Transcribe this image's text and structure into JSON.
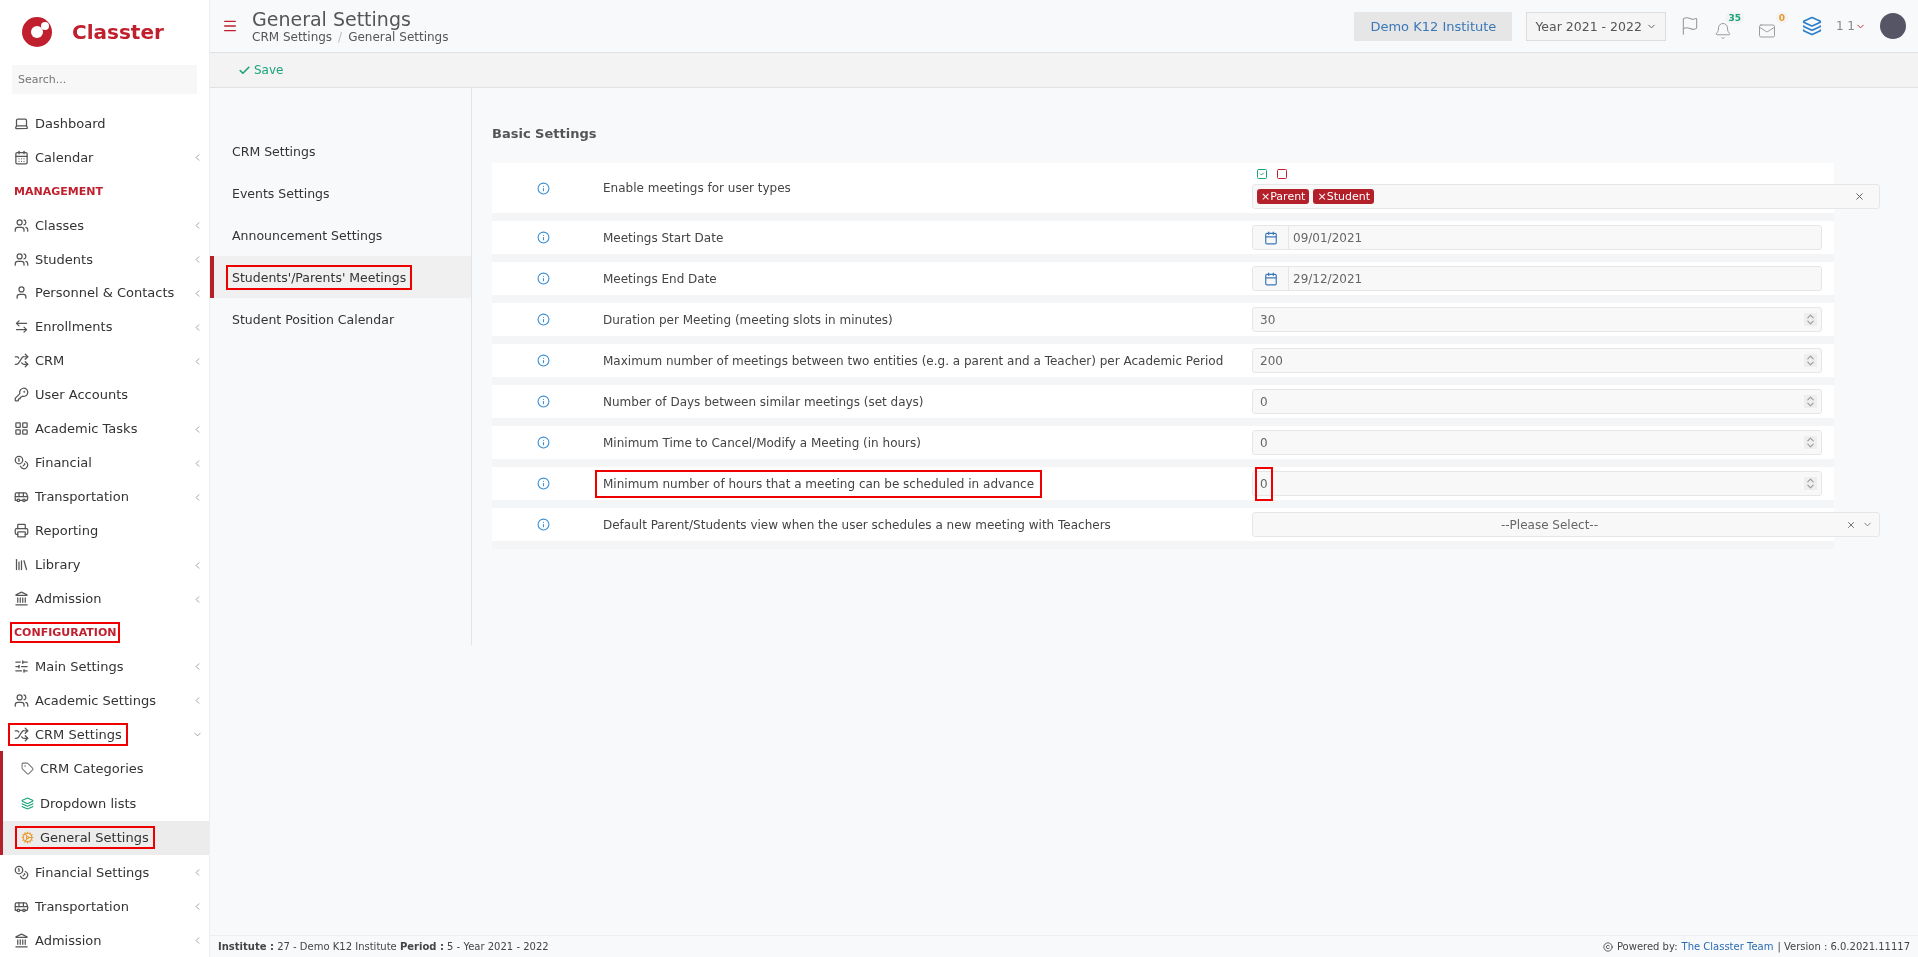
{
  "brand": {
    "name": "Classter"
  },
  "search": {
    "placeholder": "Search..."
  },
  "sidebar": {
    "items": [
      {
        "kind": "item",
        "label": "Dashboard",
        "chevron": false,
        "highlighted": false,
        "selected": false
      },
      {
        "kind": "item",
        "label": "Calendar",
        "chevron": true,
        "highlighted": false,
        "selected": false
      },
      {
        "kind": "section",
        "label": "MANAGEMENT",
        "highlighted": false
      },
      {
        "kind": "item",
        "label": "Classes",
        "chevron": true,
        "highlighted": false,
        "selected": false
      },
      {
        "kind": "item",
        "label": "Students",
        "chevron": true,
        "highlighted": false,
        "selected": false
      },
      {
        "kind": "item",
        "label": "Personnel & Contacts",
        "chevron": true,
        "highlighted": false,
        "selected": false
      },
      {
        "kind": "item",
        "label": "Enrollments",
        "chevron": true,
        "highlighted": false,
        "selected": false
      },
      {
        "kind": "item",
        "label": "CRM",
        "chevron": true,
        "highlighted": false,
        "selected": false
      },
      {
        "kind": "item",
        "label": "User Accounts",
        "chevron": false,
        "highlighted": false,
        "selected": false
      },
      {
        "kind": "item",
        "label": "Academic Tasks",
        "chevron": true,
        "highlighted": false,
        "selected": false
      },
      {
        "kind": "item",
        "label": "Financial",
        "chevron": true,
        "highlighted": false,
        "selected": false
      },
      {
        "kind": "item",
        "label": "Transportation",
        "chevron": true,
        "highlighted": false,
        "selected": false
      },
      {
        "kind": "item",
        "label": "Reporting",
        "chevron": false,
        "highlighted": false,
        "selected": false
      },
      {
        "kind": "item",
        "label": "Library",
        "chevron": true,
        "highlighted": false,
        "selected": false
      },
      {
        "kind": "item",
        "label": "Admission",
        "chevron": true,
        "highlighted": false,
        "selected": false
      },
      {
        "kind": "section",
        "label": "CONFIGURATION",
        "highlighted": true
      },
      {
        "kind": "item",
        "label": "Main Settings",
        "chevron": true,
        "highlighted": false,
        "selected": false
      },
      {
        "kind": "item",
        "label": "Academic Settings",
        "chevron": true,
        "highlighted": false,
        "selected": false
      },
      {
        "kind": "item",
        "label": "CRM Settings",
        "chevron": true,
        "highlighted": true,
        "selected": false,
        "expanded": true,
        "children": [
          {
            "label": "CRM Categories",
            "highlighted": false,
            "selected": false
          },
          {
            "label": "Dropdown lists",
            "highlighted": false,
            "selected": false
          },
          {
            "label": "General Settings",
            "highlighted": true,
            "selected": true
          }
        ]
      },
      {
        "kind": "item",
        "label": "Financial Settings",
        "chevron": true,
        "highlighted": false,
        "selected": false
      },
      {
        "kind": "item",
        "label": "Transportation",
        "chevron": true,
        "highlighted": false,
        "selected": false
      },
      {
        "kind": "item",
        "label": "Admission",
        "chevron": true,
        "highlighted": false,
        "selected": false
      }
    ]
  },
  "header": {
    "title": "General Settings",
    "breadcrumb": [
      "CRM Settings",
      "General Settings"
    ],
    "breadcrumb_separator": "/",
    "institute": "Demo K12 Institute",
    "year": "Year 2021 - 2022",
    "notifications": "35",
    "messages": "0",
    "user": "1 1"
  },
  "toolbar": {
    "save": "Save"
  },
  "subnav": [
    {
      "label": "CRM Settings",
      "selected": false,
      "highlighted": false
    },
    {
      "label": "Events Settings",
      "selected": false,
      "highlighted": false
    },
    {
      "label": "Announcement Settings",
      "selected": false,
      "highlighted": false
    },
    {
      "label": "Students'/Parents' Meetings",
      "selected": true,
      "highlighted": true
    },
    {
      "label": "Student Position Calendar",
      "selected": false,
      "highlighted": false
    }
  ],
  "section_title": "Basic Settings",
  "settings": [
    {
      "kind": "tags",
      "label": "Enable meetings for user types",
      "highlighted": false,
      "tags": [
        {
          "remove": "×",
          "label": "Parent"
        },
        {
          "remove": "×",
          "label": "Student"
        }
      ]
    },
    {
      "kind": "date",
      "label": "Meetings Start Date",
      "value": "09/01/2021",
      "highlighted": false
    },
    {
      "kind": "date",
      "label": "Meetings End Date",
      "value": "29/12/2021",
      "highlighted": false
    },
    {
      "kind": "number",
      "label": "Duration per Meeting (meeting slots in minutes)",
      "value": "30",
      "highlighted": false
    },
    {
      "kind": "number",
      "label": "Maximum number of meetings between two entities (e.g. a parent and a Teacher) per Academic Period",
      "value": "200",
      "highlighted": false
    },
    {
      "kind": "number",
      "label": "Number of Days between similar meetings (set days)",
      "value": "0",
      "highlighted": false
    },
    {
      "kind": "number",
      "label": "Minimum Time to Cancel/Modify a Meeting (in hours)",
      "value": "0",
      "highlighted": false
    },
    {
      "kind": "number",
      "label": "Minimum number of hours that a meeting can be scheduled in advance",
      "value": "0",
      "highlighted": true
    },
    {
      "kind": "select",
      "label": "Default Parent/Students view when the user schedules a new meeting with Teachers",
      "placeholder": "--Please Select--",
      "highlighted": false
    }
  ],
  "footer": {
    "institute_label": "Institute :",
    "institute": "27 - Demo K12 Institute",
    "period_label": "Period :",
    "period": "5 - Year 2021 - 2022",
    "powered": "Powered by:",
    "team": "The Classter Team",
    "version": "| Version : 6.0.2021.11117"
  }
}
